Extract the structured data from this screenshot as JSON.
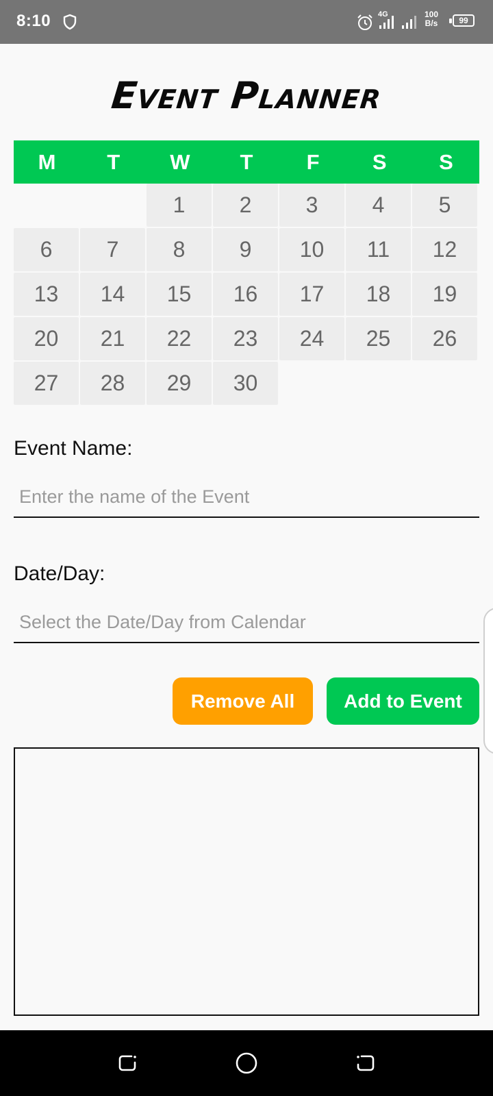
{
  "status_bar": {
    "time": "8:10",
    "network_type": "4G",
    "speed_value": "100",
    "speed_unit": "B/s",
    "battery": "99"
  },
  "app": {
    "title": "Event Planner"
  },
  "calendar": {
    "weekdays": [
      "M",
      "T",
      "W",
      "T",
      "F",
      "S",
      "S"
    ],
    "header_color": "#00c853",
    "leading_empty_cells": 2,
    "days": [
      "1",
      "2",
      "3",
      "4",
      "5",
      "6",
      "7",
      "8",
      "9",
      "10",
      "11",
      "12",
      "13",
      "14",
      "15",
      "16",
      "17",
      "18",
      "19",
      "20",
      "21",
      "22",
      "23",
      "24",
      "25",
      "26",
      "27",
      "28",
      "29",
      "30"
    ]
  },
  "form": {
    "event_name_label": "Event Name:",
    "event_name_placeholder": "Enter the name of the Event",
    "event_name_value": "",
    "date_label": "Date/Day:",
    "date_placeholder": "Select the Date/Day from Calendar",
    "date_value": ""
  },
  "actions": {
    "remove_all_label": "Remove All",
    "remove_all_color": "#ffa000",
    "add_label": "Add to Event",
    "add_color": "#00c853"
  },
  "events_list": {
    "items": []
  },
  "nav_bar": {
    "icons": [
      "recent-apps-icon",
      "home-icon",
      "back-icon"
    ]
  }
}
